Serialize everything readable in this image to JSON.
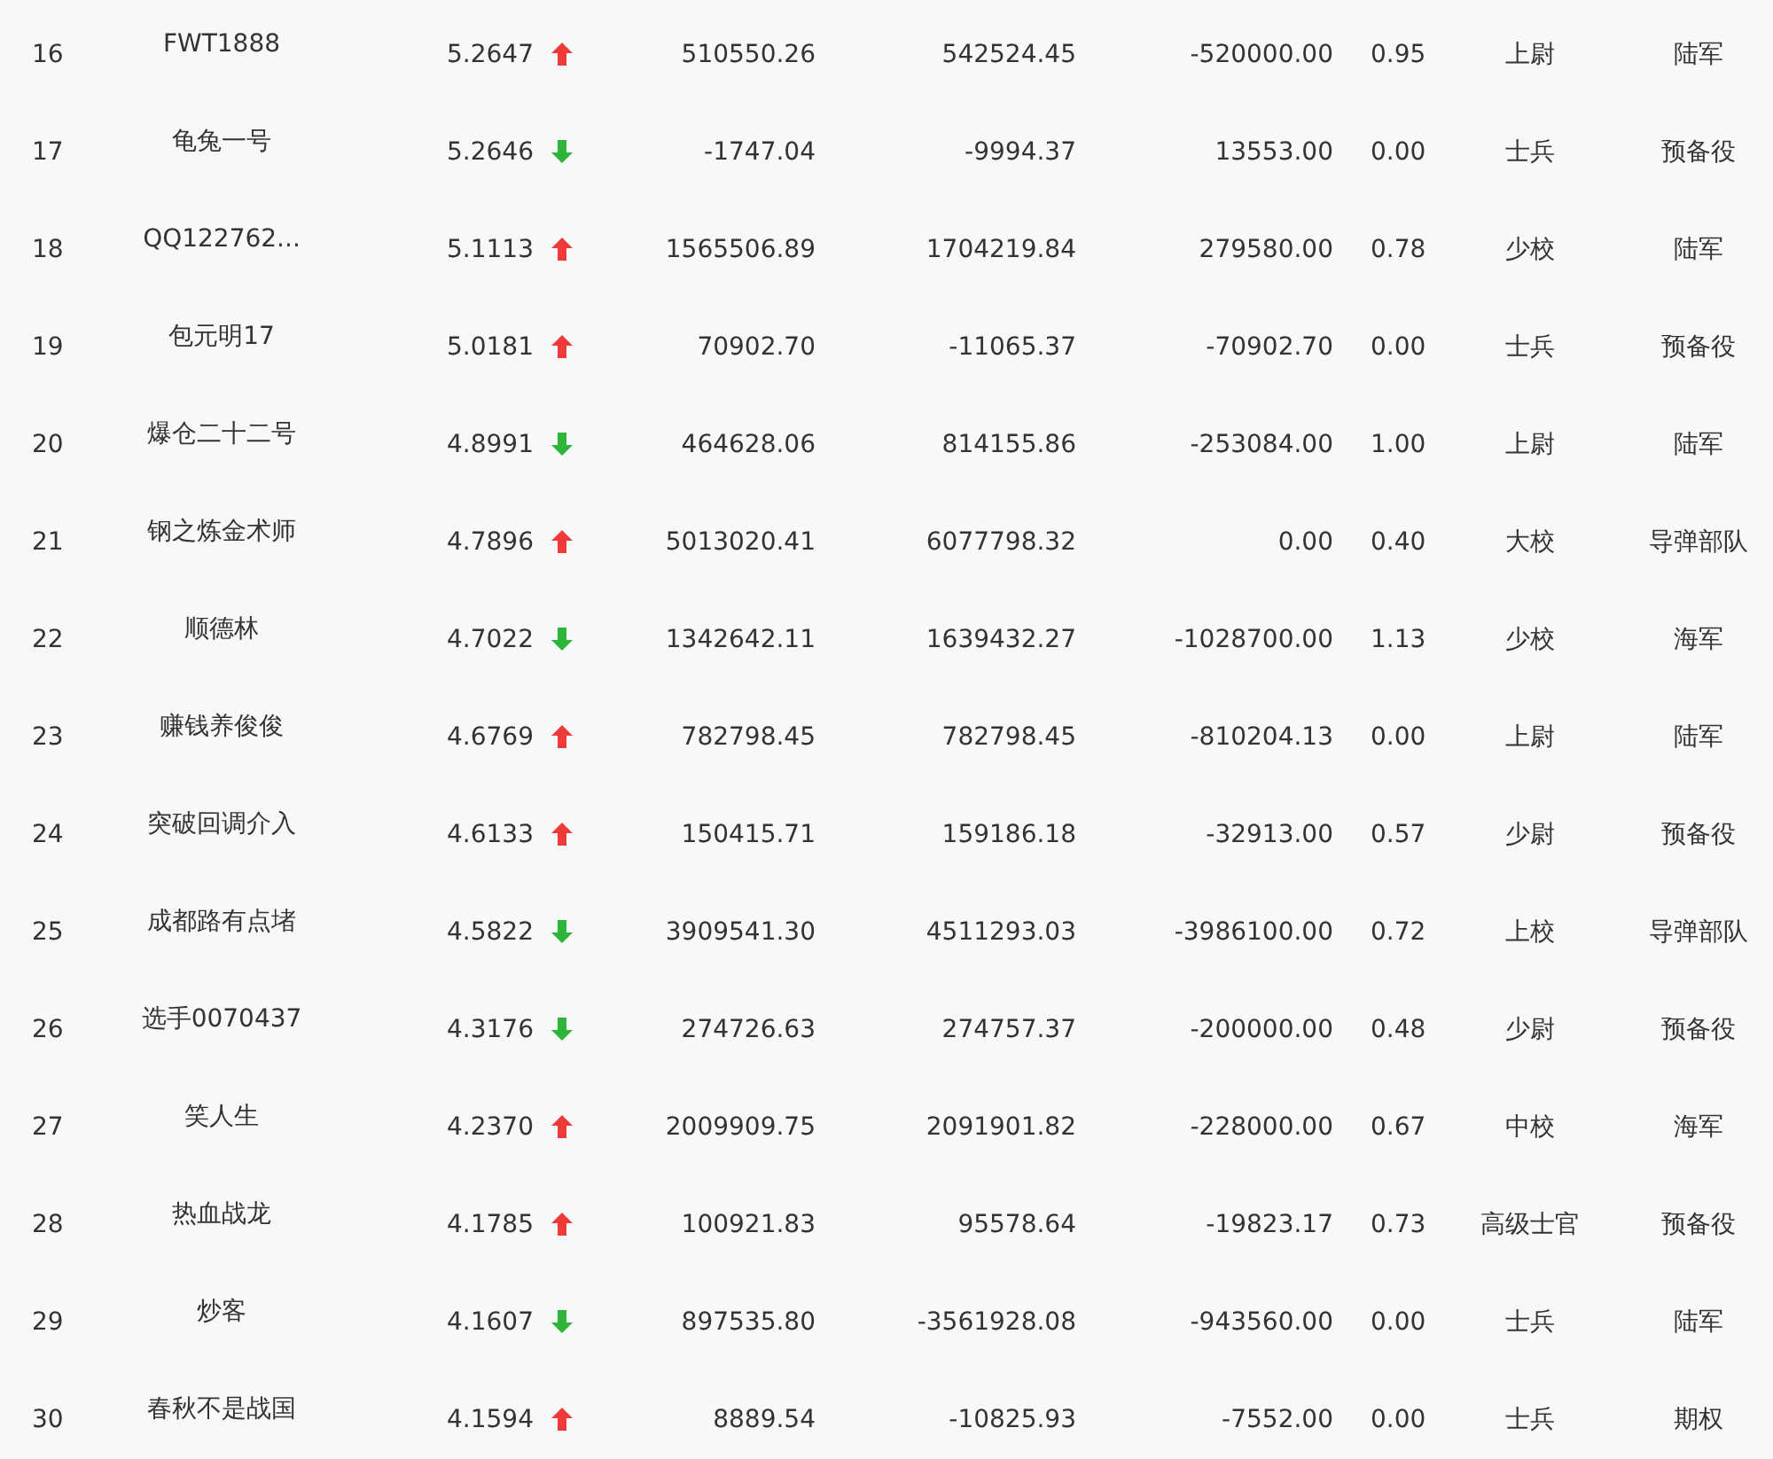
{
  "rows": [
    {
      "rank": "16",
      "name": "FWT1888",
      "value": "5.2647",
      "kind": "up",
      "column_4": "510550.26",
      "column_5": "542524.45",
      "column_6": "-520000.00",
      "column_7": "0.95",
      "column_8": "上尉",
      "column_9": "陆军"
    },
    {
      "rank": "17",
      "name": "龟兔一号",
      "value": "5.2646",
      "kind": "down",
      "column_4": "-1747.04",
      "column_5": "-9994.37",
      "column_6": "13553.00",
      "column_7": "0.00",
      "column_8": "士兵",
      "column_9": "预备役"
    },
    {
      "rank": "18",
      "name": "QQ122762...",
      "value": "5.1113",
      "kind": "up",
      "column_4": "1565506.89",
      "column_5": "1704219.84",
      "column_6": "279580.00",
      "column_7": "0.78",
      "column_8": "少校",
      "column_9": "陆军"
    },
    {
      "rank": "19",
      "name": "包元明17",
      "value": "5.0181",
      "kind": "up",
      "column_4": "70902.70",
      "column_5": "-11065.37",
      "column_6": "-70902.70",
      "column_7": "0.00",
      "column_8": "士兵",
      "column_9": "预备役"
    },
    {
      "rank": "20",
      "name": "爆仓二十二号",
      "value": "4.8991",
      "kind": "down",
      "column_4": "464628.06",
      "column_5": "814155.86",
      "column_6": "-253084.00",
      "column_7": "1.00",
      "column_8": "上尉",
      "column_9": "陆军"
    },
    {
      "rank": "21",
      "name": "钢之炼金术师",
      "value": "4.7896",
      "kind": "up",
      "column_4": "5013020.41",
      "column_5": "6077798.32",
      "column_6": "0.00",
      "column_7": "0.40",
      "column_8": "大校",
      "column_9": "导弹部队"
    },
    {
      "rank": "22",
      "name": "顺德林",
      "value": "4.7022",
      "kind": "down",
      "column_4": "1342642.11",
      "column_5": "1639432.27",
      "column_6": "-1028700.00",
      "column_7": "1.13",
      "column_8": "少校",
      "column_9": "海军"
    },
    {
      "rank": "23",
      "name": "赚钱养俊俊",
      "value": "4.6769",
      "kind": "up",
      "column_4": "782798.45",
      "column_5": "782798.45",
      "column_6": "-810204.13",
      "column_7": "0.00",
      "column_8": "上尉",
      "column_9": "陆军"
    },
    {
      "rank": "24",
      "name": "突破回调介入",
      "value": "4.6133",
      "kind": "up",
      "column_4": "150415.71",
      "column_5": "159186.18",
      "column_6": "-32913.00",
      "column_7": "0.57",
      "column_8": "少尉",
      "column_9": "预备役"
    },
    {
      "rank": "25",
      "name": "成都路有点堵",
      "value": "4.5822",
      "kind": "down",
      "column_4": "3909541.30",
      "column_5": "4511293.03",
      "column_6": "-3986100.00",
      "column_7": "0.72",
      "column_8": "上校",
      "column_9": "导弹部队"
    },
    {
      "rank": "26",
      "name": "选手0070437",
      "value": "4.3176",
      "kind": "down",
      "column_4": "274726.63",
      "column_5": "274757.37",
      "column_6": "-200000.00",
      "column_7": "0.48",
      "column_8": "少尉",
      "column_9": "预备役"
    },
    {
      "rank": "27",
      "name": "笑人生",
      "value": "4.2370",
      "kind": "up",
      "column_4": "2009909.75",
      "column_5": "2091901.82",
      "column_6": "-228000.00",
      "column_7": "0.67",
      "column_8": "中校",
      "column_9": "海军"
    },
    {
      "rank": "28",
      "name": "热血战龙",
      "value": "4.1785",
      "kind": "up",
      "column_4": "100921.83",
      "column_5": "95578.64",
      "column_6": "-19823.17",
      "column_7": "0.73",
      "column_8": "高级士官",
      "column_9": "预备役"
    },
    {
      "rank": "29",
      "name": "炒客",
      "value": "4.1607",
      "kind": "down",
      "column_4": "897535.80",
      "column_5": "-3561928.08",
      "column_6": "-943560.00",
      "column_7": "0.00",
      "column_8": "士兵",
      "column_9": "陆军"
    },
    {
      "rank": "30",
      "name": "春秋不是战国",
      "value": "4.1594",
      "kind": "up",
      "column_4": "8889.54",
      "column_5": "-10825.93",
      "column_6": "-7552.00",
      "column_7": "0.00",
      "column_8": "士兵",
      "column_9": "期权"
    }
  ]
}
